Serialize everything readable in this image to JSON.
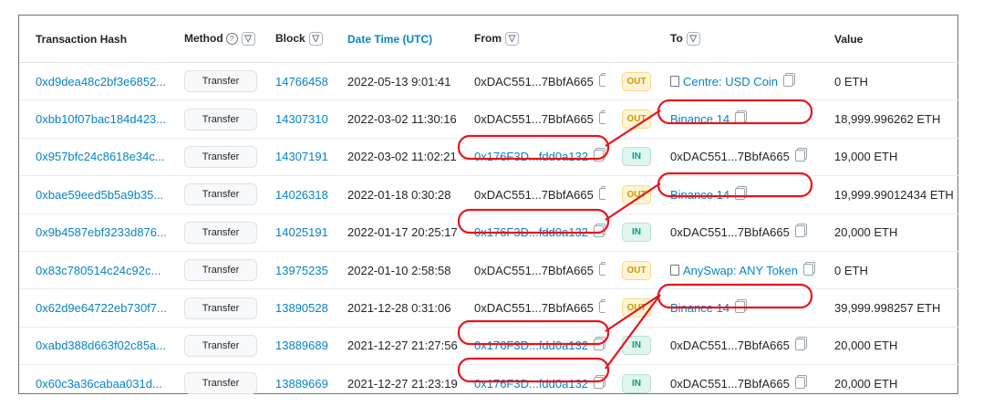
{
  "headers": {
    "hash": "Transaction Hash",
    "method": "Method",
    "block": "Block",
    "datetime": "Date Time (UTC)",
    "from": "From",
    "to": "To",
    "value": "Value"
  },
  "rows": [
    {
      "hash": "0xd9dea48c2bf3e6852...",
      "method": "Transfer",
      "block": "14766458",
      "datetime": "2022-05-13 9:01:41",
      "from": "0xDAC551...7BbfA665",
      "dir": "OUT",
      "to": "Centre: USD Coin",
      "value": "0 ETH"
    },
    {
      "hash": "0xbb10f07bac184d423...",
      "method": "Transfer",
      "block": "14307310",
      "datetime": "2022-03-02 11:30:16",
      "from": "0xDAC551...7BbfA665",
      "dir": "OUT",
      "to": "Binance 14",
      "value": "18,999.996262 ETH"
    },
    {
      "hash": "0x957bfc24c8618e34c...",
      "method": "Transfer",
      "block": "14307191",
      "datetime": "2022-03-02 11:02:21",
      "from": "0x176F3D...fdd0a132",
      "dir": "IN",
      "to": "0xDAC551...7BbfA665",
      "value": "19,000 ETH"
    },
    {
      "hash": "0xbae59eed5b5a9b35...",
      "method": "Transfer",
      "block": "14026318",
      "datetime": "2022-01-18 0:30:28",
      "from": "0xDAC551...7BbfA665",
      "dir": "OUT",
      "to": "Binance 14",
      "value": "19,999.99012434 ETH"
    },
    {
      "hash": "0x9b4587ebf3233d876...",
      "method": "Transfer",
      "block": "14025191",
      "datetime": "2022-01-17 20:25:17",
      "from": "0x176F3D...fdd0a132",
      "dir": "IN",
      "to": "0xDAC551...7BbfA665",
      "value": "20,000 ETH"
    },
    {
      "hash": "0x83c780514c24c92c...",
      "method": "Transfer",
      "block": "13975235",
      "datetime": "2022-01-10 2:58:58",
      "from": "0xDAC551...7BbfA665",
      "dir": "OUT",
      "to": "AnySwap: ANY Token",
      "value": "0 ETH"
    },
    {
      "hash": "0x62d9e64722eb730f7...",
      "method": "Transfer",
      "block": "13890528",
      "datetime": "2021-12-28 0:31:06",
      "from": "0xDAC551...7BbfA665",
      "dir": "OUT",
      "to": "Binance 14",
      "value": "39,999.998257 ETH"
    },
    {
      "hash": "0xabd388d663f02c85a...",
      "method": "Transfer",
      "block": "13889689",
      "datetime": "2021-12-27 21:27:56",
      "from": "0x176F3D...fdd0a132",
      "dir": "IN",
      "to": "0xDAC551...7BbfA665",
      "value": "20,000 ETH"
    },
    {
      "hash": "0x60c3a36cabaa031d...",
      "method": "Transfer",
      "block": "13889669",
      "datetime": "2021-12-27 21:23:19",
      "from": "0x176F3D...fdd0a132",
      "dir": "IN",
      "to": "0xDAC551...7BbfA665",
      "value": "20,000 ETH"
    }
  ],
  "colors": {
    "link": "#0784c3",
    "annotation": "#e8141c",
    "out_badge": "#cc9a06",
    "in_badge": "#00a186"
  },
  "icons": {
    "help": "question-circle-icon",
    "filter": "filter-icon",
    "copy": "copy-icon",
    "contract": "contract-document-icon"
  }
}
